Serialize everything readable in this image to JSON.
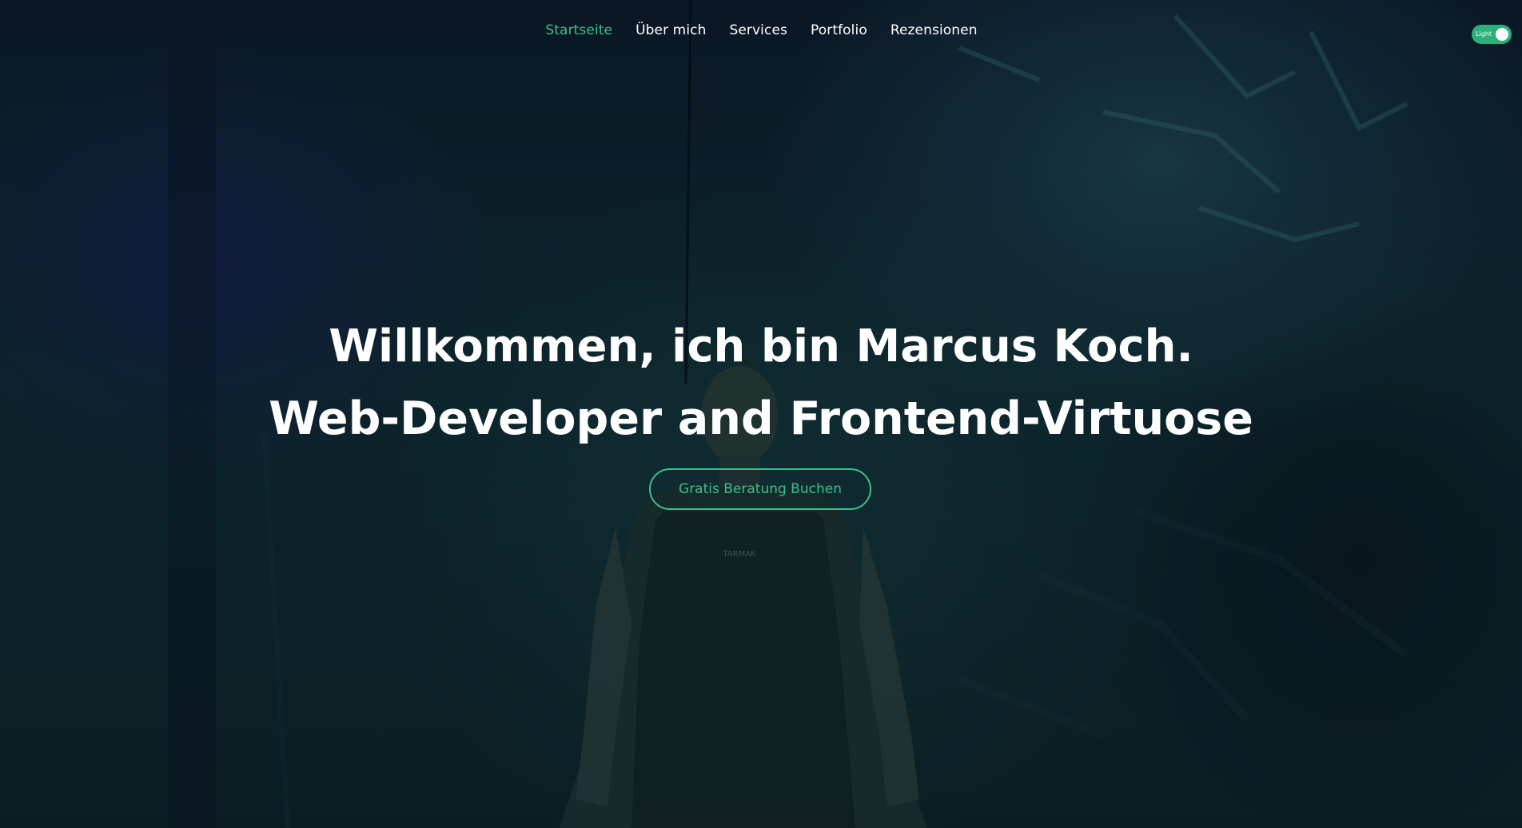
{
  "nav": {
    "items": [
      {
        "label": "Startseite",
        "active": true
      },
      {
        "label": "Über mich",
        "active": false
      },
      {
        "label": "Services",
        "active": false
      },
      {
        "label": "Portfolio",
        "active": false
      },
      {
        "label": "Rezensionen",
        "active": false
      }
    ]
  },
  "theme_toggle": {
    "label": "Light",
    "state": "on"
  },
  "hero": {
    "headline_1": "Willkommen, ich bin Marcus Koch.",
    "headline_2": "Web-Developer and Frontend-Virtuose",
    "cta_label": "Gratis Beratung Buchen",
    "shirt_logo": "TARMAK"
  },
  "colors": {
    "accent": "#3dbf8c",
    "toggle": "#2cb07a",
    "text": "#ffffff",
    "background": "#0f2a32"
  }
}
